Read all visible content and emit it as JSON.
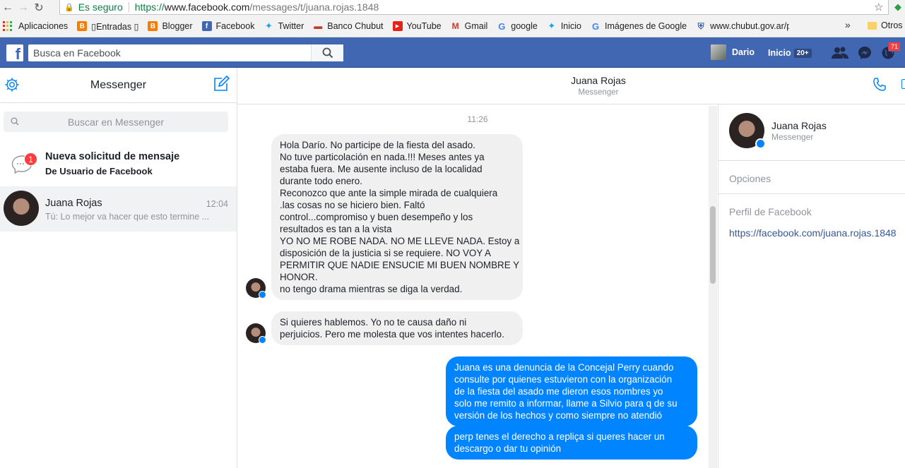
{
  "browser": {
    "secure_label": "Es seguro",
    "url_scheme": "https://",
    "url_host": "www.facebook.com",
    "url_path": "/messages/t/juana.rojas.1848"
  },
  "bookmarks": {
    "items": [
      {
        "label": "Aplicaciones",
        "icon": "apps-grid-icon"
      },
      {
        "label": "▯Entradas ▯",
        "icon": "blogger-icon",
        "color": "#f57d00"
      },
      {
        "label": "Blogger",
        "icon": "blogger-icon",
        "color": "#f57d00"
      },
      {
        "label": "Facebook",
        "icon": "facebook-icon",
        "color": "#4267b2"
      },
      {
        "label": "Twitter",
        "icon": "twitter-icon",
        "color": "#1da1f2"
      },
      {
        "label": "Banco Chubut",
        "icon": "bank-icon",
        "color": "#c0392b"
      },
      {
        "label": "YouTube",
        "icon": "youtube-icon",
        "color": "#e62117"
      },
      {
        "label": "Gmail",
        "icon": "gmail-icon",
        "color": "#d93025"
      },
      {
        "label": "google",
        "icon": "google-icon",
        "color": "#4285f4"
      },
      {
        "label": "Inicio",
        "icon": "twitter-icon",
        "color": "#1da1f2"
      },
      {
        "label": "Imágenes de Google",
        "icon": "google-icon",
        "color": "#4285f4"
      },
      {
        "label": "www.chubut.gov.ar/p",
        "icon": "shield-icon",
        "color": "#3a5ea8"
      }
    ],
    "more": "»",
    "other": "Otros"
  },
  "fb": {
    "search_placeholder": "Busca en Facebook",
    "user_name": "Dario",
    "home_label": "Inicio",
    "home_count": "20+",
    "notif_count": "71"
  },
  "sidebar": {
    "title": "Messenger",
    "search_placeholder": "Buscar en Messenger",
    "request": {
      "badge": "1",
      "title": "Nueva solicitud de mensaje",
      "subtitle": "De Usuario de Facebook"
    },
    "conversations": [
      {
        "name": "Juana Rojas",
        "time": "12:04",
        "snippet": "Tú: Lo mejor va hacer que esto termine ..."
      }
    ]
  },
  "thread": {
    "name": "Juana Rojas",
    "subtitle": "Messenger",
    "timestamp": "11:26",
    "messages": [
      {
        "from": "them",
        "lines": [
          "Hola Darío. No participe de la fiesta del asado.",
          "No tuve particolación en nada.!!! Meses antes ya",
          "estaba fuera. Me ausente incluso de la localidad",
          "durante todo enero.",
          "Reconozco que ante la simple mirada de cualquiera",
          ".las cosas no se hiciero bien. Faltó",
          "control...compromiso y buen desempeño y los",
          "resultados es tan a la vista",
          "YO NO ME ROBE NADA. NO ME LLEVE NADA. Estoy a",
          "disposición de la justicia si se requiere. NO VOY A",
          "PERMITIR QUE NADIE ENSUCIE MI BUEN NOMBRE Y",
          "HONOR.",
          "no tengo drama mientras se diga la verdad."
        ]
      },
      {
        "from": "them",
        "lines": [
          "Si quieres hablemos. Yo no te causa daño ni",
          "perjuicios. Pero me molesta que vos intentes hacerlo."
        ]
      },
      {
        "from": "me",
        "lines": [
          "Juana es una denuncia de la Concejal Perry cuando",
          "consulte por quienes estuvieron con la organización",
          "de la fiesta del asado me dieron esos nombres yo",
          "solo me remito a informar, llame a Silvio para q de su",
          "versión de los hechos y como siempre no atendió"
        ]
      },
      {
        "from": "me",
        "lines": [
          "perp tenes el derecho a repliça si queres hacer un",
          "descargo o dar tu opinión"
        ]
      }
    ]
  },
  "info_panel": {
    "name": "Juana Rojas",
    "subtitle": "Messenger",
    "options_label": "Opciones",
    "profile_label": "Perfil de Facebook",
    "profile_link": "https://facebook.com/juana.rojas.1848"
  },
  "colors": {
    "fb_blue": "#4267b2",
    "messenger_blue": "#0084ff",
    "bubble_gray": "#f1f0f0"
  }
}
